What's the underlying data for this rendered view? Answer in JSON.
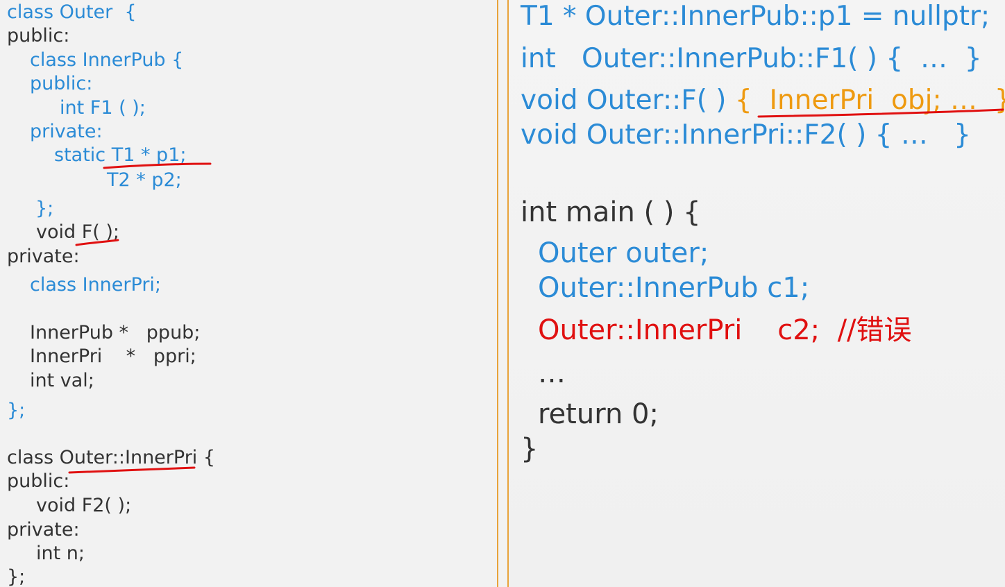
{
  "left_code": {
    "l1": "class Outer  {",
    "l2": "public:",
    "l3": "class InnerPub {",
    "l4": "public:",
    "l5": "int F1 ( );",
    "l6": "private:",
    "l7": "static T1 * p1;",
    "l8": "T2 * p2;",
    "l9": "};",
    "l10": "void F( );",
    "l11": "private:",
    "l12": "class InnerPri;",
    "l13": "InnerPub *   ppub;",
    "l14": "InnerPri    *   ppri;",
    "l15": "int val;",
    "l16": "};",
    "l17": "class Outer::InnerPri {",
    "l18": "public:",
    "l19": "void F2( );",
    "l20": "private:",
    "l21": "int n;",
    "l22": "};"
  },
  "right_code": {
    "r1": "T1 * Outer::InnerPub::p1 = nullptr;",
    "r2": "int   Outer::InnerPub::F1( ) {  …  }",
    "r3a": "void Outer::F( ) ",
    "r3b": "{  InnerPri  obj; …  }",
    "r4": "void Outer::InnerPri::F2( ) { …   }",
    "r5": "int main ( ) {",
    "r6": "Outer outer;",
    "r7": "Outer::InnerPub c1;",
    "r8": "Outer::InnerPri    c2;  //错误",
    "r9": "…",
    "r10": "return 0;",
    "r11": "}"
  },
  "colors": {
    "blue": "#2b8bd6",
    "dark": "#333333",
    "orange": "#ee9a10",
    "red": "#e01010",
    "divider": "#e8a33a"
  }
}
